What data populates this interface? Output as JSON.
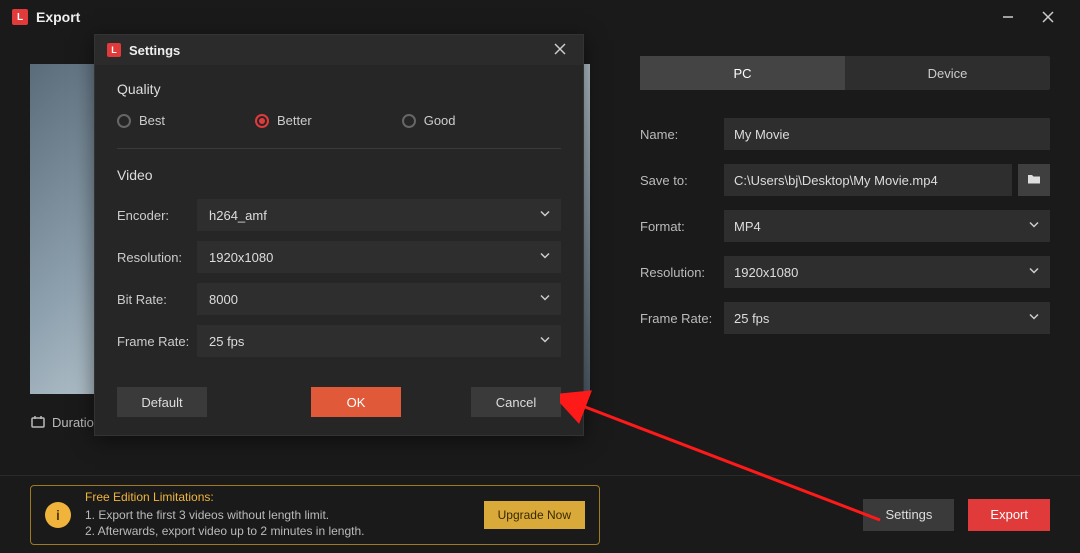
{
  "window": {
    "title": "Export"
  },
  "preview": {
    "duration_label": "Duration:"
  },
  "tabs": {
    "pc": "PC",
    "device": "Device"
  },
  "form": {
    "name_label": "Name:",
    "name_value": "My Movie",
    "save_label": "Save to:",
    "save_value": "C:\\Users\\bj\\Desktop\\My Movie.mp4",
    "format_label": "Format:",
    "format_value": "MP4",
    "resolution_label": "Resolution:",
    "resolution_value": "1920x1080",
    "framerate_label": "Frame Rate:",
    "framerate_value": "25 fps"
  },
  "limitations": {
    "title": "Free Edition Limitations:",
    "line1": "1. Export the first 3 videos without length limit.",
    "line2": "2. Afterwards, export video up to 2 minutes in length.",
    "upgrade": "Upgrade Now"
  },
  "footer": {
    "settings": "Settings",
    "export": "Export"
  },
  "dialog": {
    "title": "Settings",
    "quality_section": "Quality",
    "quality_best": "Best",
    "quality_better": "Better",
    "quality_good": "Good",
    "video_section": "Video",
    "encoder_label": "Encoder:",
    "encoder_value": "h264_amf",
    "resolution_label": "Resolution:",
    "resolution_value": "1920x1080",
    "bitrate_label": "Bit Rate:",
    "bitrate_value": "8000",
    "framerate_label": "Frame Rate:",
    "framerate_value": "25 fps",
    "default": "Default",
    "ok": "OK",
    "cancel": "Cancel"
  }
}
